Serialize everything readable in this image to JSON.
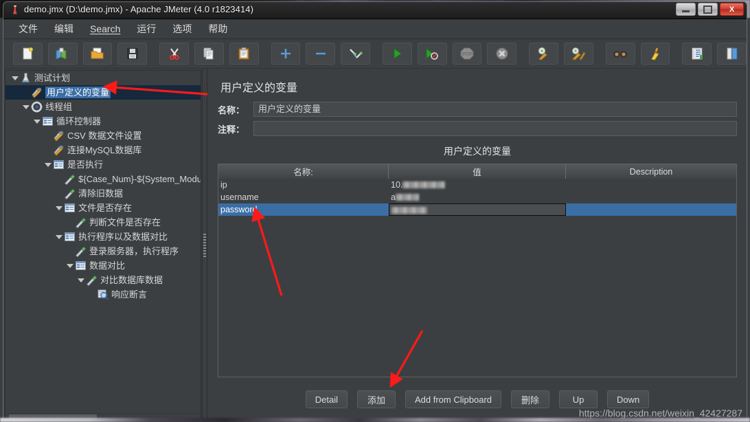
{
  "window": {
    "title": "demo.jmx (D:\\demo.jmx) - Apache JMeter (4.0 r1823414)",
    "minimize_label": "",
    "maximize_label": "",
    "close_label": "X"
  },
  "menubar": {
    "items": [
      {
        "label": "文件",
        "underlined": false
      },
      {
        "label": "编辑",
        "underlined": false
      },
      {
        "label": "Search",
        "underlined": true
      },
      {
        "label": "运行",
        "underlined": false
      },
      {
        "label": "选项",
        "underlined": false
      },
      {
        "label": "帮助",
        "underlined": false
      }
    ]
  },
  "toolbar": {
    "buttons": [
      {
        "name": "new-icon"
      },
      {
        "name": "templates-icon"
      },
      {
        "name": "open-icon"
      },
      {
        "name": "save-icon"
      },
      {
        "name": "cut-icon"
      },
      {
        "name": "copy-icon"
      },
      {
        "name": "paste-icon"
      },
      {
        "name": "expand-all-icon"
      },
      {
        "name": "collapse-all-icon"
      },
      {
        "name": "toggle-icon"
      },
      {
        "name": "start-icon"
      },
      {
        "name": "start-no-pauses-icon"
      },
      {
        "name": "stop-icon"
      },
      {
        "name": "shutdown-icon"
      },
      {
        "name": "clear-icon"
      },
      {
        "name": "clear-all-icon"
      },
      {
        "name": "search-icon"
      },
      {
        "name": "reset-search-icon"
      },
      {
        "name": "function-helper-icon"
      },
      {
        "name": "templates-panel-icon"
      }
    ]
  },
  "tree": {
    "nodes": [
      {
        "label": "测试计划",
        "indent": 0,
        "icon": "test-plan-icon",
        "toggle": true,
        "selected": false
      },
      {
        "label": "用户定义的变量",
        "indent": 1,
        "icon": "config-element-icon",
        "toggle": false,
        "selected": true
      },
      {
        "label": "线程组",
        "indent": 1,
        "icon": "thread-group-icon",
        "toggle": true,
        "selected": false
      },
      {
        "label": "循环控制器",
        "indent": 2,
        "icon": "controller-icon",
        "toggle": true,
        "selected": false
      },
      {
        "label": "CSV 数据文件设置",
        "indent": 3,
        "icon": "config-element-icon",
        "toggle": false,
        "selected": false
      },
      {
        "label": "连接MySQL数据库",
        "indent": 3,
        "icon": "config-element-icon",
        "toggle": false,
        "selected": false
      },
      {
        "label": "是否执行",
        "indent": 3,
        "icon": "controller-icon",
        "toggle": true,
        "selected": false
      },
      {
        "label": "${Case_Num}-${System_Module}-${D",
        "indent": 4,
        "icon": "sampler-icon",
        "toggle": false,
        "selected": false
      },
      {
        "label": "清除旧数据",
        "indent": 4,
        "icon": "sampler-icon",
        "toggle": false,
        "selected": false
      },
      {
        "label": "文件是否存在",
        "indent": 4,
        "icon": "controller-icon",
        "toggle": true,
        "selected": false
      },
      {
        "label": "判断文件是否存在",
        "indent": 5,
        "icon": "sampler-icon",
        "toggle": false,
        "selected": false
      },
      {
        "label": "执行程序以及数据对比",
        "indent": 4,
        "icon": "controller-icon",
        "toggle": true,
        "selected": false
      },
      {
        "label": "登录服务器，执行程序",
        "indent": 5,
        "icon": "sampler-icon",
        "toggle": false,
        "selected": false
      },
      {
        "label": "数据对比",
        "indent": 5,
        "icon": "controller-icon",
        "toggle": true,
        "selected": false
      },
      {
        "label": "对比数据库数据",
        "indent": 6,
        "icon": "sampler-icon",
        "toggle": true,
        "selected": false
      },
      {
        "label": "响应断言",
        "indent": 7,
        "icon": "assertion-icon",
        "toggle": false,
        "selected": false
      }
    ]
  },
  "panel": {
    "title": "用户定义的变量",
    "name_label": "名称：",
    "name_value": "用户定义的变量",
    "comment_label": "注释：",
    "comment_value": "",
    "table_title": "用户定义的变量",
    "table": {
      "columns": [
        "名称:",
        "值",
        "Description"
      ],
      "rows": [
        {
          "name": "ip",
          "value_prefix": "10.",
          "value_redacted": true,
          "redact_width": 62,
          "description": "",
          "selected": false,
          "editing": false
        },
        {
          "name": "username",
          "value_prefix": "a",
          "value_redacted": true,
          "redact_width": 34,
          "description": "",
          "selected": false,
          "editing": false
        },
        {
          "name": "password",
          "value_prefix": "",
          "value_redacted": true,
          "redact_width": 52,
          "description": "",
          "selected": true,
          "editing": true
        }
      ]
    },
    "buttons": [
      {
        "label": "Detail",
        "name": "detail-button"
      },
      {
        "label": "添加",
        "name": "add-button"
      },
      {
        "label": "Add from Clipboard",
        "name": "add-from-clipboard-button"
      },
      {
        "label": "删除",
        "name": "delete-button"
      },
      {
        "label": "Up",
        "name": "up-button"
      },
      {
        "label": "Down",
        "name": "down-button"
      }
    ]
  },
  "watermark": "https://blog.csdn.net/weixin_42427287",
  "annotations": {
    "arrow_color": "#ff1a1a",
    "arrows": [
      {
        "name": "arrow-to-selected-tree-node",
        "points": "from (300,136) to (150,126)"
      },
      {
        "name": "arrow-to-table-area",
        "points": "from (408,428) to (370,302)"
      },
      {
        "name": "arrow-to-add-button",
        "points": "from (614,482) to (568,563)"
      }
    ]
  },
  "colors": {
    "window_bg": "#3c3f41",
    "selection_blue": "#3a6ea5",
    "tree_selection_bg": "#16283c",
    "text": "#d6d6d6",
    "accent_red": "#ff1a1a"
  }
}
